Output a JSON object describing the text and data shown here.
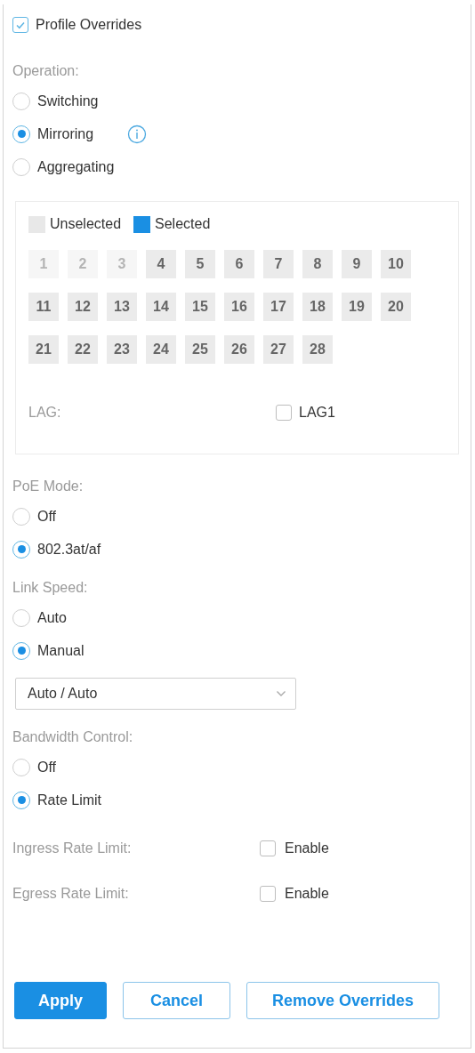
{
  "profile_overrides": {
    "label": "Profile Overrides",
    "checked": true
  },
  "operation": {
    "label": "Operation:",
    "options": [
      {
        "label": "Switching",
        "selected": false,
        "info": false
      },
      {
        "label": "Mirroring",
        "selected": true,
        "info": true
      },
      {
        "label": "Aggregating",
        "selected": false,
        "info": false
      }
    ]
  },
  "ports": {
    "legend": [
      {
        "label": "Unselected",
        "color": "#e8e8e8"
      },
      {
        "label": "Selected",
        "color": "#1a8fe3"
      }
    ],
    "items": [
      {
        "label": "1",
        "disabled": true,
        "selected": false
      },
      {
        "label": "2",
        "disabled": true,
        "selected": false
      },
      {
        "label": "3",
        "disabled": true,
        "selected": false
      },
      {
        "label": "4",
        "disabled": false,
        "selected": false
      },
      {
        "label": "5",
        "disabled": false,
        "selected": false
      },
      {
        "label": "6",
        "disabled": false,
        "selected": false
      },
      {
        "label": "7",
        "disabled": false,
        "selected": false
      },
      {
        "label": "8",
        "disabled": false,
        "selected": false
      },
      {
        "label": "9",
        "disabled": false,
        "selected": false
      },
      {
        "label": "10",
        "disabled": false,
        "selected": false
      },
      {
        "label": "11",
        "disabled": false,
        "selected": false
      },
      {
        "label": "12",
        "disabled": false,
        "selected": false
      },
      {
        "label": "13",
        "disabled": false,
        "selected": false
      },
      {
        "label": "14",
        "disabled": false,
        "selected": false
      },
      {
        "label": "15",
        "disabled": false,
        "selected": false
      },
      {
        "label": "16",
        "disabled": false,
        "selected": false
      },
      {
        "label": "17",
        "disabled": false,
        "selected": false
      },
      {
        "label": "18",
        "disabled": false,
        "selected": false
      },
      {
        "label": "19",
        "disabled": false,
        "selected": false
      },
      {
        "label": "20",
        "disabled": false,
        "selected": false
      },
      {
        "label": "21",
        "disabled": false,
        "selected": false
      },
      {
        "label": "22",
        "disabled": false,
        "selected": false
      },
      {
        "label": "23",
        "disabled": false,
        "selected": false
      },
      {
        "label": "24",
        "disabled": false,
        "selected": false
      },
      {
        "label": "25",
        "disabled": false,
        "selected": false
      },
      {
        "label": "26",
        "disabled": false,
        "selected": false
      },
      {
        "label": "27",
        "disabled": false,
        "selected": false
      },
      {
        "label": "28",
        "disabled": false,
        "selected": false
      }
    ],
    "lag": {
      "label": "LAG:",
      "option": "LAG1",
      "checked": false
    }
  },
  "poe_mode": {
    "label": "PoE Mode:",
    "options": [
      {
        "label": "Off",
        "selected": false
      },
      {
        "label": "802.3at/af",
        "selected": true
      }
    ]
  },
  "link_speed": {
    "label": "Link Speed:",
    "options": [
      {
        "label": "Auto",
        "selected": false
      },
      {
        "label": "Manual",
        "selected": true
      }
    ],
    "select": {
      "value": "Auto / Auto"
    }
  },
  "bandwidth_control": {
    "label": "Bandwidth Control:",
    "options": [
      {
        "label": "Off",
        "selected": false
      },
      {
        "label": "Rate Limit",
        "selected": true
      }
    ],
    "limits": [
      {
        "label": "Ingress Rate Limit:",
        "option": "Enable",
        "checked": false
      },
      {
        "label": "Egress Rate Limit:",
        "option": "Enable",
        "checked": false
      }
    ]
  },
  "buttons": [
    {
      "label": "Apply",
      "kind": "primary"
    },
    {
      "label": "Cancel",
      "kind": "secondary"
    },
    {
      "label": "Remove Overrides",
      "kind": "secondary"
    }
  ]
}
